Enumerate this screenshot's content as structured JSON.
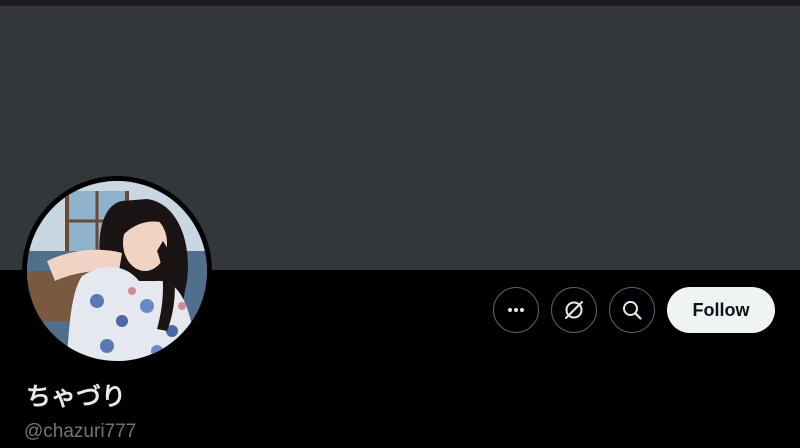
{
  "profile": {
    "display_name": "ちゃづり",
    "handle": "@chazuri777"
  },
  "actions": {
    "more_icon": "more-dots-icon",
    "grok_icon": "grok-icon",
    "search_icon": "search-icon",
    "follow_label": "Follow"
  },
  "colors": {
    "background": "#000000",
    "banner": "#33363a",
    "text_primary": "#e7e9ea",
    "text_secondary": "#71767b",
    "follow_button_bg": "#eff3f4",
    "button_border": "#536471"
  }
}
